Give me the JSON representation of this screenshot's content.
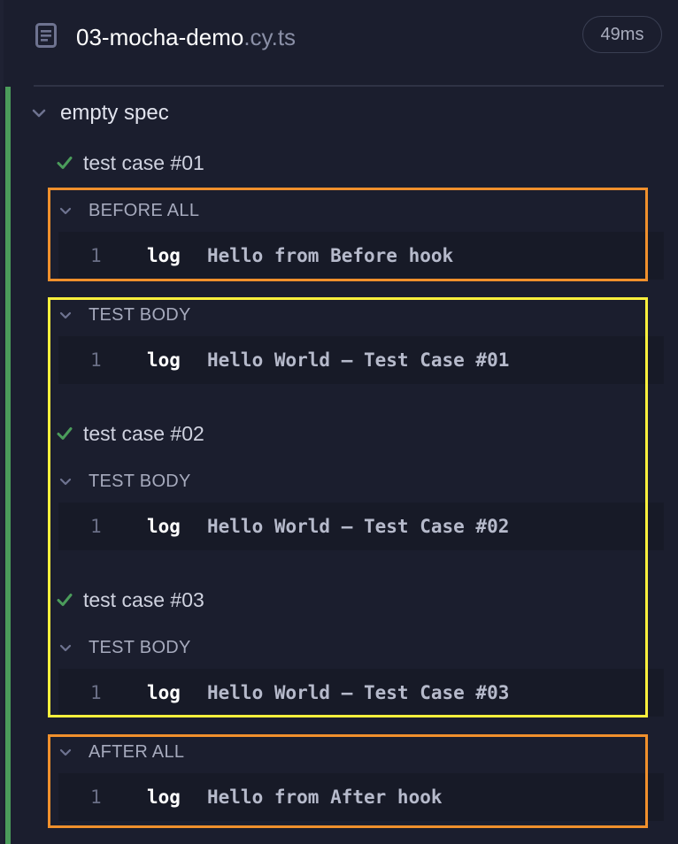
{
  "spec": {
    "name": "03-mocha-demo",
    "extension": ".cy.ts",
    "duration": "49ms"
  },
  "suite": {
    "label": "empty spec"
  },
  "tests": [
    {
      "label": "test case #01"
    },
    {
      "label": "test case #02"
    },
    {
      "label": "test case #03"
    }
  ],
  "hooks": {
    "before_all": "BEFORE ALL",
    "test_body": "TEST BODY",
    "after_all": "AFTER ALL"
  },
  "commands": [
    {
      "number": "1",
      "name": "log",
      "message": "Hello from Before hook"
    },
    {
      "number": "1",
      "name": "log",
      "message": "Hello World – Test Case #01"
    },
    {
      "number": "1",
      "name": "log",
      "message": "Hello World – Test Case #02"
    },
    {
      "number": "1",
      "name": "log",
      "message": "Hello World – Test Case #03"
    },
    {
      "number": "1",
      "name": "log",
      "message": "Hello from After hook"
    }
  ],
  "colors": {
    "background": "#1b1e2e",
    "pass": "#4b9c5b",
    "highlight_hooks": "#f0902c",
    "highlight_body": "#fbf03c"
  }
}
